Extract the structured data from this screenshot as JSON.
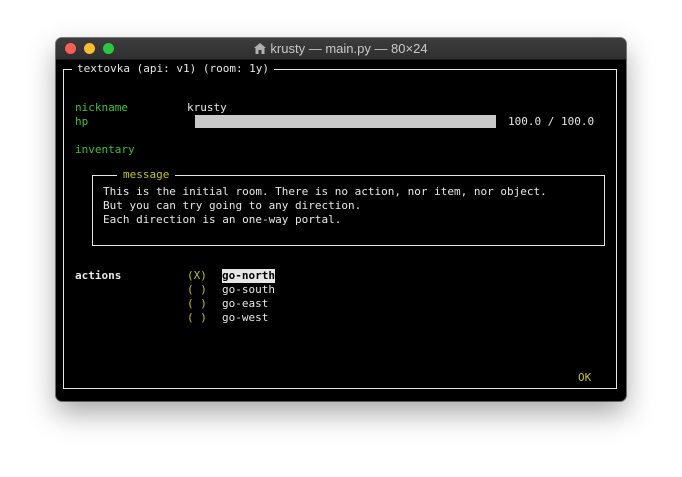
{
  "window": {
    "title": "krusty — main.py — 80×24"
  },
  "app": {
    "frame_title": "textovka (api: v1) (room: 1y)"
  },
  "stats": {
    "nickname_label": "nickname",
    "nickname_value": "krusty",
    "hp_label": "hp",
    "hp_fraction": 1.0,
    "hp_text": "100.0 / 100.0",
    "inventory_label": "inventary"
  },
  "message": {
    "title": "message",
    "lines": [
      "This is the initial room. There is no action, nor item, nor object.",
      "But you can try going to any direction.",
      "Each direction is an one-way portal."
    ]
  },
  "actions": {
    "label": "actions",
    "options": [
      {
        "marker": "(X)",
        "label": "go-north"
      },
      {
        "marker": "( )",
        "label": "go-south"
      },
      {
        "marker": "( )",
        "label": "go-east"
      },
      {
        "marker": "( )",
        "label": "go-west"
      }
    ]
  },
  "ok_label": "OK",
  "colors": {
    "label_green": "#3fbf3f",
    "radio_yellow": "#c5c030",
    "hp_bar": "#c9c9c9"
  }
}
